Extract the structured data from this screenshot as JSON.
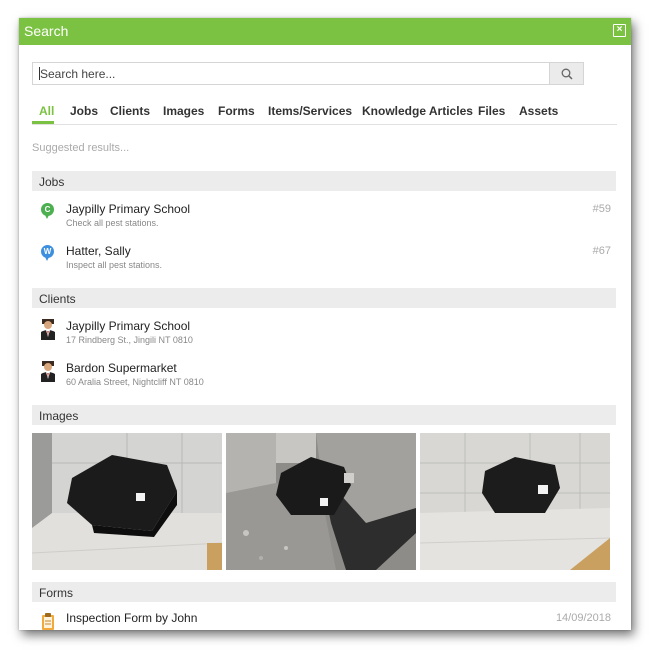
{
  "dialog": {
    "title": "Search",
    "close_icon": "close-icon"
  },
  "search": {
    "placeholder": "Search here...",
    "button_icon": "search-icon"
  },
  "tabs": [
    {
      "label": "All",
      "active": true
    },
    {
      "label": "Jobs"
    },
    {
      "label": "Clients"
    },
    {
      "label": "Images"
    },
    {
      "label": "Forms"
    },
    {
      "label": "Items/Services"
    },
    {
      "label": "Knowledge Articles"
    },
    {
      "label": "Files"
    },
    {
      "label": "Assets"
    }
  ],
  "suggested_label": "Suggested results...",
  "sections": {
    "jobs": {
      "title": "Jobs",
      "items": [
        {
          "name": "Jaypilly Primary School",
          "description": "Check all pest stations.",
          "number": "#59",
          "pin_letter": "C",
          "pin_color": "#4caf50"
        },
        {
          "name": "Hatter, Sally",
          "description": "Inspect all pest stations.",
          "number": "#67",
          "pin_letter": "W",
          "pin_color": "#3d8fe0"
        }
      ]
    },
    "clients": {
      "title": "Clients",
      "items": [
        {
          "name": "Jaypilly Primary School",
          "address": "17 Rindberg St., Jingili NT 0810"
        },
        {
          "name": "Bardon Supermarket",
          "address": "60 Aralia Street, Nightcliff NT 0810"
        }
      ]
    },
    "images": {
      "title": "Images"
    },
    "forms": {
      "title": "Forms",
      "items": [
        {
          "name": "Inspection Form by John",
          "date": "14/09/2018"
        }
      ]
    }
  },
  "colors": {
    "accent": "#7bc242",
    "section_bg": "#ececec"
  }
}
